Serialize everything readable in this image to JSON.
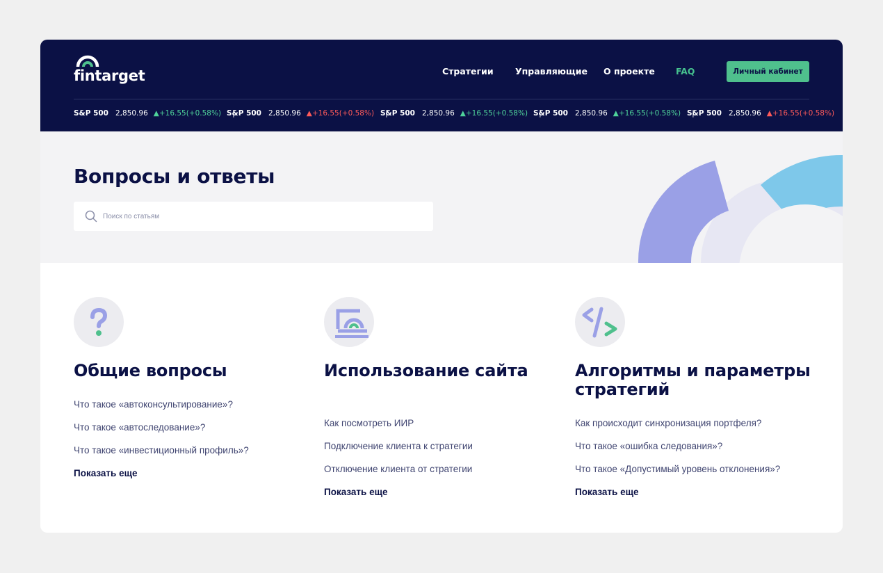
{
  "brand": {
    "name": "fintarget"
  },
  "nav": {
    "items": [
      {
        "label": "Стратегии"
      },
      {
        "label": "Управляющие"
      },
      {
        "label": "О проекте"
      },
      {
        "label": "FAQ"
      }
    ],
    "active": "FAQ",
    "cabinet_button": "Личный кабинет"
  },
  "ticker": [
    {
      "symbol": "S&P 500",
      "price": "2,850.96",
      "change": "+16.55(+0.58%)",
      "direction": "up"
    },
    {
      "symbol": "S&P 500",
      "price": "2,850.96",
      "change": "+16.55(+0.58%)",
      "direction": "down"
    },
    {
      "symbol": "S&P 500",
      "price": "2,850.96",
      "change": "+16.55(+0.58%)",
      "direction": "up"
    },
    {
      "symbol": "S&P 500",
      "price": "2,850.96",
      "change": "+16.55(+0.58%)",
      "direction": "up"
    },
    {
      "symbol": "S&P 500",
      "price": "2,850.96",
      "change": "+16.55(+0.58%)",
      "direction": "down"
    }
  ],
  "ticker_separator": "|",
  "hero": {
    "title": "Вопросы и ответы",
    "search_placeholder": "Поиск по статьям"
  },
  "categories": [
    {
      "icon": "question-icon",
      "title": "Общие вопросы",
      "questions": [
        "Что такое «автоконсультирование»?",
        "Что такое «автоследование»?",
        "Что такое «инвестиционный профиль»?"
      ],
      "more": "Показать еще"
    },
    {
      "icon": "laptop-icon",
      "title": "Использование сайта",
      "questions": [
        "Как посмотреть ИИР",
        "Подключение клиента к стратегии",
        "Отключение клиента от стратегии"
      ],
      "more": "Показать еще"
    },
    {
      "icon": "code-icon",
      "title": "Алгоритмы и параметры стратегий",
      "questions": [
        "Как происходит синхронизация портфеля?",
        "Что такое «ошибка следования»?",
        "Что такое «Допустимый уровень отклонения»?"
      ],
      "more": "Показать еще"
    }
  ],
  "colors": {
    "navy": "#0b1145",
    "green": "#4fc08d",
    "purple": "#9aa0e6",
    "blue": "#7ec8ea",
    "up": "#4fd39a",
    "down": "#ff5a5a"
  }
}
